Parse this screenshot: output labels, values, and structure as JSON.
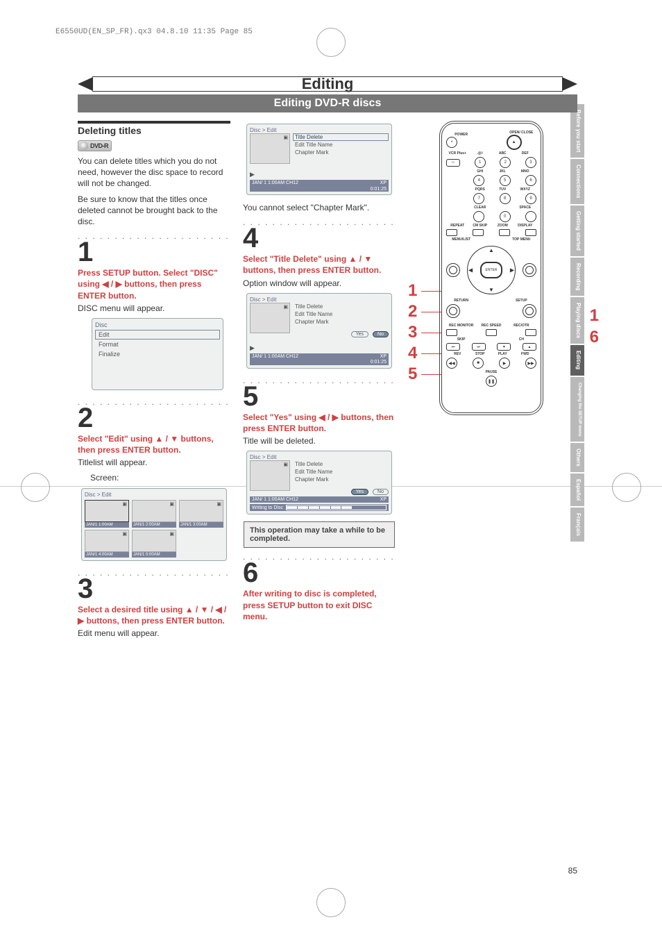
{
  "preheader": "E6550UD(EN_SP_FR).qx3  04.8.10  11:35  Page 85",
  "title": "Editing",
  "subtitle": "Editing DVD-R discs",
  "section_title": "Deleting titles",
  "disc_badge": "DVD-R",
  "intro1": "You can delete titles which you do not need, however the disc space to record will not be changed.",
  "intro2": "Be sure to know that the titles once deleted cannot be brought back to the disc.",
  "steps": {
    "1": {
      "num": "1",
      "lead": "Press SETUP button. Select \"DISC\" using ◀ / ▶ buttons, then press ENTER button.",
      "follow": "DISC menu will appear."
    },
    "2": {
      "num": "2",
      "lead": "Select \"Edit\" using ▲ / ▼ buttons, then press ENTER button.",
      "follow": "Titlelist will appear.",
      "screen_label": "Screen:"
    },
    "3": {
      "num": "3",
      "lead": "Select a desired title using ▲ / ▼ / ◀ / ▶ buttons, then press ENTER button.",
      "follow": "Edit menu will appear."
    },
    "4": {
      "num": "4",
      "lead": "Select \"Title Delete\" using ▲ / ▼ buttons, then press ENTER button.",
      "follow": "Option window will appear."
    },
    "5": {
      "num": "5",
      "lead": "Select \"Yes\" using ◀ / ▶ buttons, then press ENTER button.",
      "follow": "Title will be deleted."
    },
    "6": {
      "num": "6",
      "lead": "After writing to disc is completed, press SETUP button to exit DISC menu."
    }
  },
  "col2_note": "You cannot select \"Chapter Mark\".",
  "note_box": "This operation may take a while to be completed.",
  "disc_menu": {
    "header": "Disc",
    "items": [
      "Edit",
      "Format",
      "Finalize"
    ],
    "selected": 0
  },
  "osd": {
    "path": "Disc > Edit",
    "menu": [
      "Title Delete",
      "Edit Title Name",
      "Chapter Mark"
    ],
    "status_left": "JAN/ 1   1:00AM  CH12",
    "status_right": "XP",
    "time": "0:01:25",
    "yes": "Yes",
    "no": "No",
    "writing": "Writing to Disc"
  },
  "title_grid": {
    "path": "Disc > Edit",
    "captions": [
      "JAN/1  1:00AM",
      "JAN/1  2:00AM",
      "JAN/1  3:00AM",
      "JAN/1  4:00AM",
      "JAN/1  5:00AM"
    ]
  },
  "callouts_left": [
    "1",
    "2",
    "3",
    "4",
    "5"
  ],
  "callouts_right": [
    "1",
    "6"
  ],
  "side_tabs": [
    {
      "label": "Before you start",
      "active": false
    },
    {
      "label": "Connections",
      "active": false
    },
    {
      "label": "Getting started",
      "active": false
    },
    {
      "label": "Recording",
      "active": false
    },
    {
      "label": "Playing discs",
      "active": false
    },
    {
      "label": "Editing",
      "active": true
    },
    {
      "label": "Changing the SETUP menu",
      "active": false,
      "small": true
    },
    {
      "label": "Others",
      "active": false
    },
    {
      "label": "Español",
      "active": false
    },
    {
      "label": "Français",
      "active": false
    }
  ],
  "remote": {
    "labels": {
      "power": "POWER",
      "open_close": "OPEN/\nCLOSE",
      "vcr_plus": "VCR Plus+",
      "at": ".@/:",
      "abc": "ABC",
      "def": "DEF",
      "ghi": "GHI",
      "jkl": "JKL",
      "mno": "MNO",
      "pqrs": "PQRS",
      "tuv": "TUV",
      "wxyz": "WXYZ",
      "clear": "CLEAR",
      "space": "SPACE",
      "repeat": "REPEAT",
      "cm_skip": "CM SKIP",
      "zoom": "ZOOM",
      "display": "DISPLAY",
      "menu_list": "MENU/LIST",
      "top_menu": "TOP MENU",
      "enter": "ENTER",
      "return": "RETURN",
      "setup": "SETUP",
      "rec_monitor": "REC\nMONITOR",
      "rec_speed": "REC\nSPEED",
      "rec_otr": "REC/OTR",
      "skip": "SKIP",
      "ch": "CH",
      "rev": "REV",
      "stop": "STOP",
      "play": "PLAY",
      "fwd": "FWD",
      "pause": "PAUSE"
    },
    "digits": [
      "1",
      "2",
      "3",
      "4",
      "5",
      "6",
      "7",
      "8",
      "9",
      "0"
    ]
  },
  "page_number": "85"
}
